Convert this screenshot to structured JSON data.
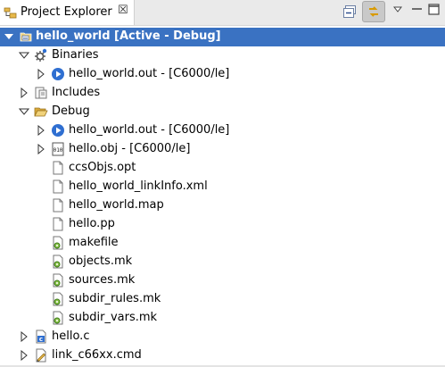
{
  "view": {
    "title": "Project Explorer",
    "close_glyph": "☒",
    "toolbar": {
      "collapse_all": "collapse-all-icon",
      "link_with_editor": "link-with-editor-icon",
      "view_menu": "view-menu-icon",
      "minimize": "minimize-icon",
      "maximize": "maximize-icon"
    }
  },
  "tree": {
    "project": {
      "label": "hello_world  [Active - Debug]",
      "expanded": true,
      "selected": true
    },
    "binaries": {
      "label": "Binaries",
      "expanded": true,
      "items": [
        {
          "label": "hello_world.out - [C6000/le]",
          "expanded": false
        }
      ]
    },
    "includes": {
      "label": "Includes",
      "expanded": false
    },
    "debug": {
      "label": "Debug",
      "expanded": true,
      "items": [
        {
          "label": "hello_world.out - [C6000/le]",
          "icon": "executable-icon",
          "expandable": true
        },
        {
          "label": "hello.obj - [C6000/le]",
          "icon": "object-file-icon",
          "expandable": true
        },
        {
          "label": "ccsObjs.opt",
          "icon": "file-icon",
          "expandable": false
        },
        {
          "label": "hello_world_linkInfo.xml",
          "icon": "file-icon",
          "expandable": false
        },
        {
          "label": "hello_world.map",
          "icon": "file-icon",
          "expandable": false
        },
        {
          "label": "hello.pp",
          "icon": "file-icon",
          "expandable": false
        },
        {
          "label": "makefile",
          "icon": "makefile-icon",
          "expandable": false
        },
        {
          "label": "objects.mk",
          "icon": "makefile-icon",
          "expandable": false
        },
        {
          "label": "sources.mk",
          "icon": "makefile-icon",
          "expandable": false
        },
        {
          "label": "subdir_rules.mk",
          "icon": "makefile-icon",
          "expandable": false
        },
        {
          "label": "subdir_vars.mk",
          "icon": "makefile-icon",
          "expandable": false
        }
      ]
    },
    "hello_c": {
      "label": "hello.c",
      "expanded": false
    },
    "link_cmd": {
      "label": "link_c66xx.cmd",
      "expanded": false
    }
  },
  "colors": {
    "selection": "#3a72c2",
    "header_bg": "#eaeaea",
    "folder": "#e8b94a",
    "executable": "#2f6fd1"
  }
}
